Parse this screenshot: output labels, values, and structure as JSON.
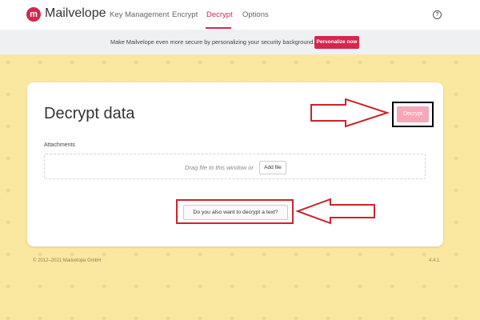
{
  "navbar": {
    "logo_glyph": "m",
    "brand": "Mailvelope",
    "items": [
      {
        "label": "Key Management"
      },
      {
        "label": "Encrypt"
      },
      {
        "label": "Decrypt",
        "active": true
      },
      {
        "label": "Options"
      }
    ],
    "help_glyph": "?"
  },
  "promo": {
    "text": "Make Mailvelope even more secure by personalizing your security background.",
    "button": "Personalize now"
  },
  "card": {
    "title": "Decrypt data",
    "decrypt_button": "Decrypt",
    "attachments_label": "Attachments",
    "drop_hint": "Drag file to this window or",
    "add_file_button": "Add file",
    "decrypt_text_button": "Do you also want to decrypt a text?"
  },
  "footer": {
    "copyright": "© 2012–2021  Mailvelope GmbH",
    "version": "4.4.1"
  },
  "colors": {
    "accent": "#d2284e",
    "annotation_red": "#c9252c",
    "background": "#fbe8a0"
  }
}
